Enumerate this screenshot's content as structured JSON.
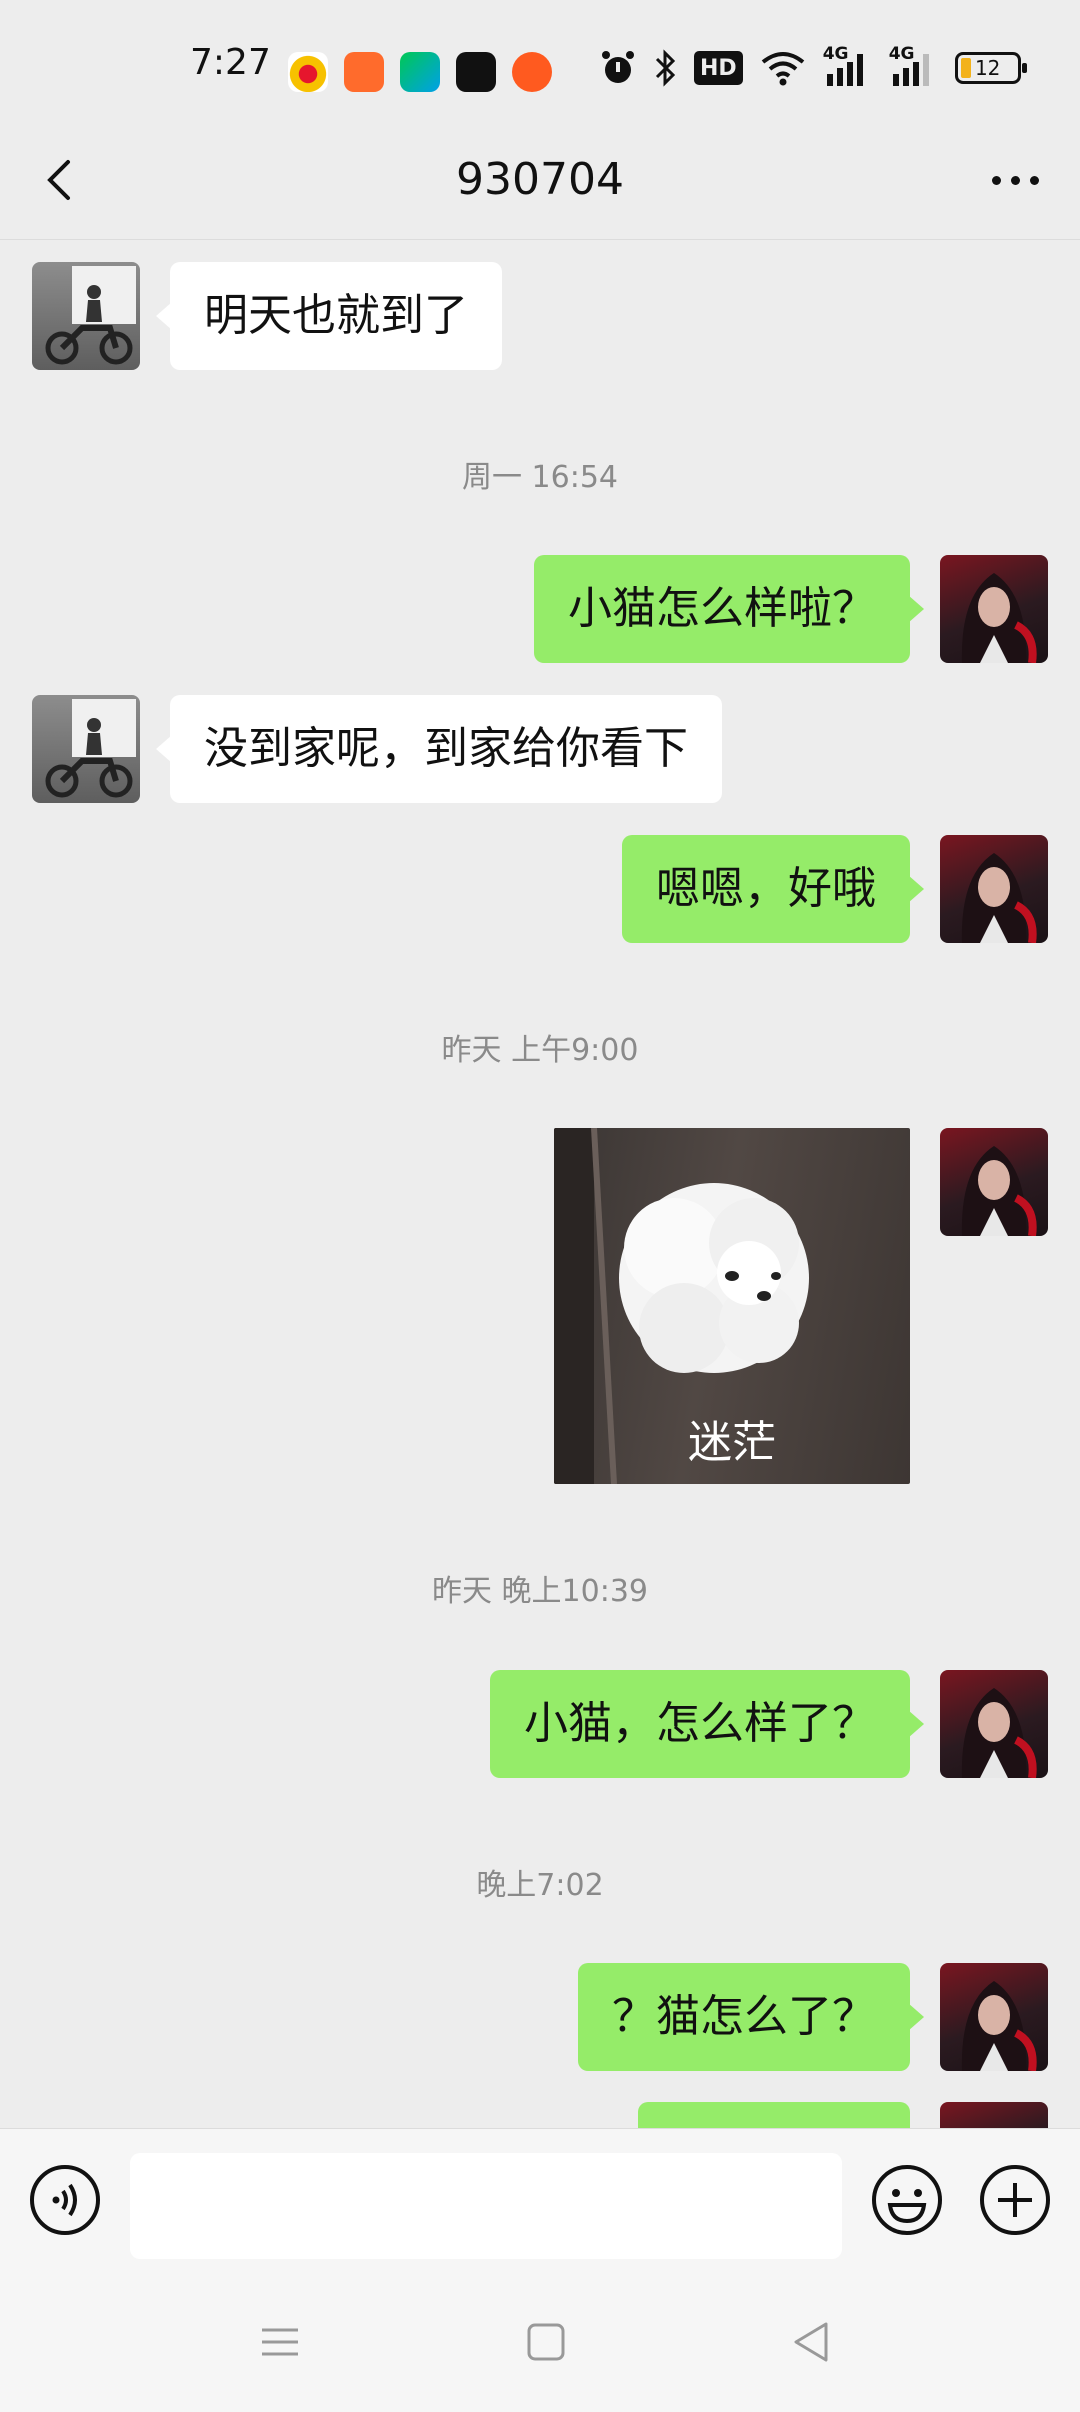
{
  "status_bar": {
    "time": "7:27",
    "app_icons": [
      "weibo-icon",
      "kuaishou-icon",
      "iqiyi-icon",
      "tiktok-icon",
      "reminder-app-icon"
    ],
    "battery_level": "12",
    "network_labels": [
      "HD",
      "4G",
      "4G"
    ]
  },
  "header": {
    "title": "930704"
  },
  "messages": [
    {
      "side": "in",
      "text": "明天也就到了"
    },
    {
      "type": "time",
      "text": "周一 16:54"
    },
    {
      "side": "out",
      "text": "小猫怎么样啦？"
    },
    {
      "side": "in",
      "text": "没到家呢，到家给你看下"
    },
    {
      "side": "out",
      "text": "嗯嗯，好哦"
    },
    {
      "type": "time",
      "text": "昨天 上午9:00"
    },
    {
      "side": "out",
      "type": "sticker",
      "caption": "迷茫"
    },
    {
      "type": "time",
      "text": "昨天 晚上10:39"
    },
    {
      "side": "out",
      "text": "小猫，怎么样了？"
    },
    {
      "type": "time",
      "text": "晚上7:02"
    },
    {
      "side": "out",
      "text": "？猫怎么了？"
    }
  ],
  "input": {
    "value": "",
    "placeholder": ""
  },
  "colors": {
    "outgoing_bubble": "#95ec69",
    "incoming_bubble": "#ffffff",
    "background": "#ededed"
  }
}
